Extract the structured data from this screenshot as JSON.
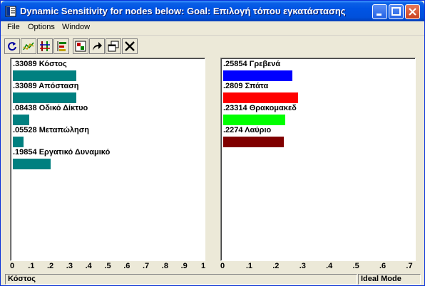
{
  "window": {
    "title": "Dynamic Sensitivity for nodes below: Goal: Επιλογή τόπου εγκατάστασης"
  },
  "menu": {
    "file": "File",
    "options": "Options",
    "window": "Window"
  },
  "toolbar": {
    "icons": [
      "refresh-icon",
      "line-chart-icon",
      "performance-icon",
      "gradient-icon",
      "head-to-head-icon",
      "export-icon",
      "copy-window-icon",
      "close-icon"
    ]
  },
  "criteria": {
    "color": "#008080",
    "items": [
      {
        "label": ".33089 Κόστος",
        "value": 0.33089
      },
      {
        "label": ".33089 Απόσταση",
        "value": 0.33089
      },
      {
        "label": ".08438 Οδικό Δίκτυο",
        "value": 0.08438
      },
      {
        "label": ".05528 Μεταπώληση",
        "value": 0.05528
      },
      {
        "label": ".19854 Εργατικό Δυναμικό",
        "value": 0.19854
      }
    ],
    "axis": {
      "ticks": [
        "0",
        ".1",
        ".2",
        ".3",
        ".4",
        ".5",
        ".6",
        ".7",
        ".8",
        ".9",
        "1"
      ],
      "max": 1.0
    }
  },
  "alternatives": {
    "items": [
      {
        "label": ".25854 Γρεβενά",
        "value": 0.25854,
        "color": "#0000ff"
      },
      {
        "label": ".2809 Σπάτα",
        "value": 0.2809,
        "color": "#ff0000"
      },
      {
        "label": ".23314 Θρακομακεδ",
        "value": 0.23314,
        "color": "#00ff00"
      },
      {
        "label": ".2274 Λαύριο",
        "value": 0.2274,
        "color": "#800000"
      }
    ],
    "axis": {
      "ticks": [
        "0",
        ".1",
        ".2",
        ".3",
        ".4",
        ".5",
        ".6",
        ".7"
      ],
      "max": 0.7
    }
  },
  "status": {
    "selected": "Κόστος",
    "mode": "Ideal Mode"
  }
}
